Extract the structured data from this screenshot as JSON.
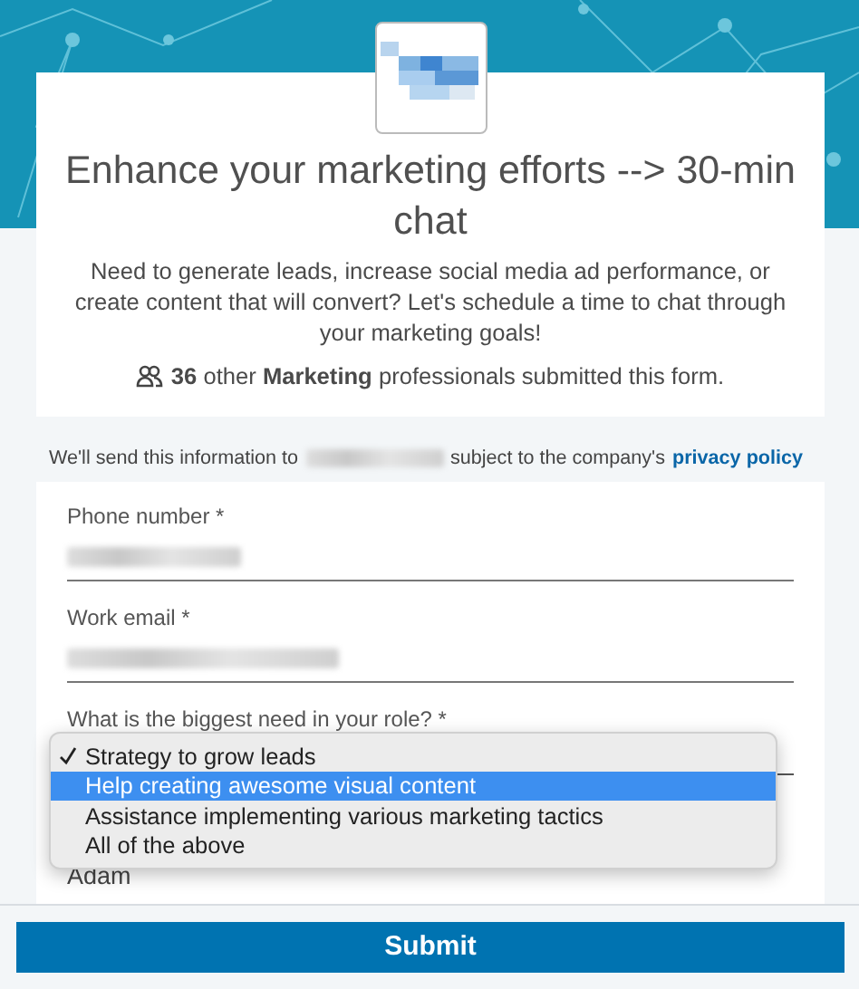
{
  "header": {
    "title": "Enhance your marketing efforts --> 30-min chat",
    "description": "Need to generate leads, increase social media ad performance, or create content that will convert? Let's schedule a time to chat through your marketing goals!",
    "social_proof": "**36** other **Marketing** professionals submitted this form."
  },
  "privacy_notice": {
    "before": "We'll send this information to",
    "after": "subject to the company's",
    "link": "privacy policy"
  },
  "fields": [
    {
      "label": "Phone number *",
      "kind": "blurred"
    },
    {
      "label": "Work email *",
      "kind": "blurred"
    },
    {
      "label": "What is the biggest need in your role? *",
      "kind": "select"
    }
  ],
  "dropdown": {
    "options": [
      {
        "label": "Strategy to grow leads",
        "checked": true,
        "selected": false
      },
      {
        "label": "Help creating awesome visual content",
        "checked": false,
        "selected": true
      },
      {
        "label": "Assistance implementing various marketing tactics",
        "checked": false,
        "selected": false
      },
      {
        "label": "All of the above",
        "checked": false,
        "selected": false
      }
    ]
  },
  "next_field_value": "Adam",
  "submit_button": "Submit"
}
